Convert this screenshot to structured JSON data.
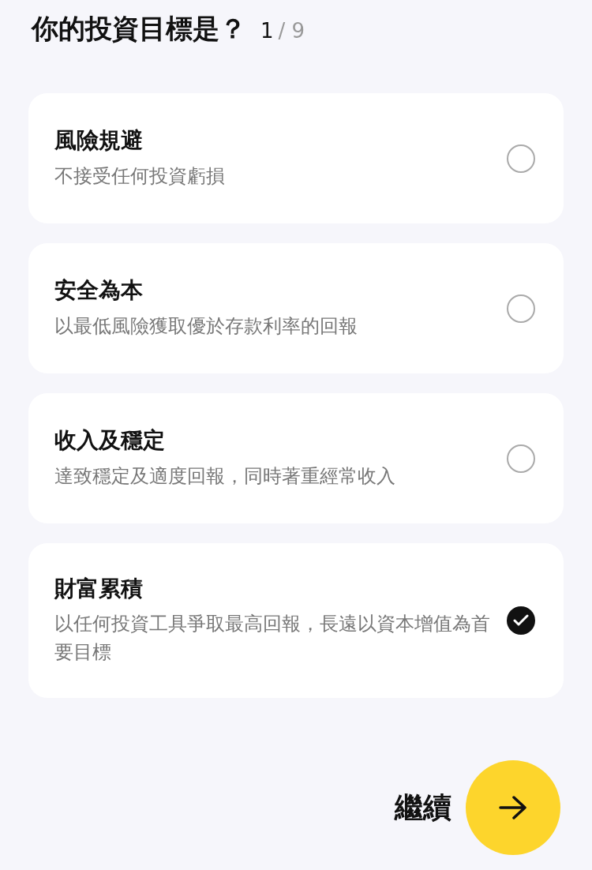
{
  "question": {
    "title": "你的投資目標是？",
    "step_current": "1",
    "step_total": "/ 9"
  },
  "options": [
    {
      "title": "風險規避",
      "description": "不接受任何投資虧損",
      "selected": false
    },
    {
      "title": "安全為本",
      "description": "以最低風險獲取優於存款利率的回報",
      "selected": false
    },
    {
      "title": "收入及穩定",
      "description": "達致穩定及適度回報，同時著重經常收入",
      "selected": false
    },
    {
      "title": "財富累積",
      "description": "以任何投資工具爭取最高回報，長遠以資本增值為首要目標",
      "selected": true
    }
  ],
  "continue_button": {
    "label": "繼續"
  }
}
